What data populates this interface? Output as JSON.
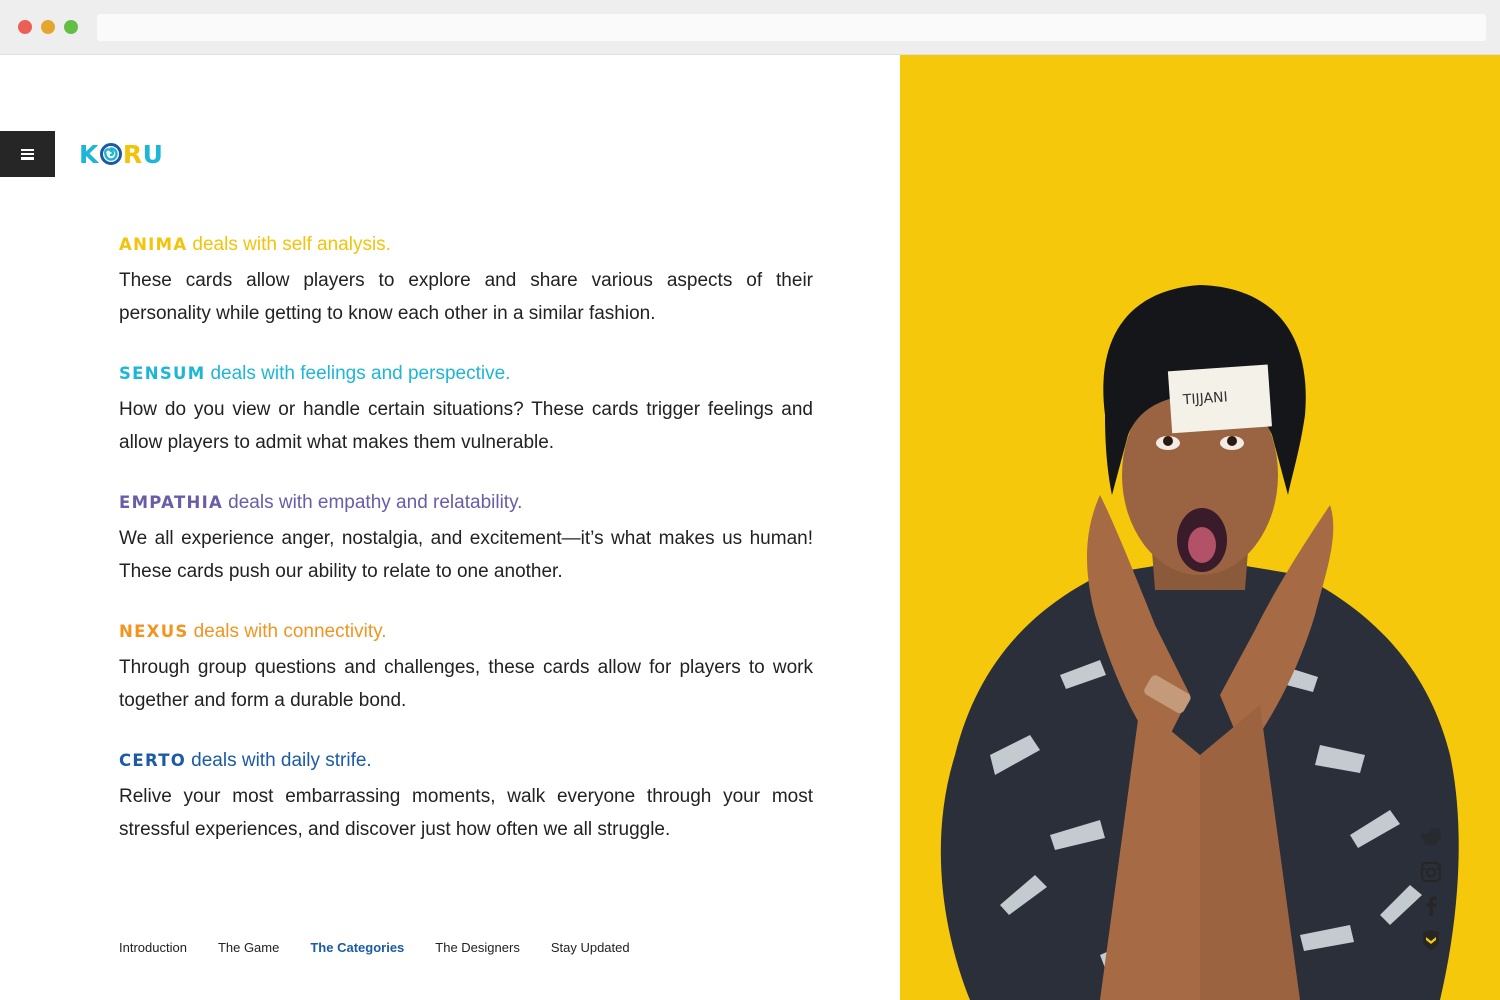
{
  "logo": {
    "k": "K",
    "r": "R",
    "u": "U"
  },
  "categories": [
    {
      "name": "ANIMA",
      "tagline": "deals with self analysis.",
      "color": "#f3c30a",
      "description": "These cards allow players to explore and share various aspects of their personality while getting to know each other in a similar fashion."
    },
    {
      "name": "SENSUM",
      "tagline": "deals with feelings and perspective.",
      "color": "#1eb6d6",
      "description": "How do you view or handle certain situations? These cards trigger feelings and allow players to admit what makes them vulnerable."
    },
    {
      "name": "EMPATHIA",
      "tagline": "deals with empathy and relatability.",
      "color": "#6a5ca8",
      "description": "We all experience anger, nostalgia, and excitement—it’s what makes us human! These cards push our ability to relate to one another."
    },
    {
      "name": "NEXUS",
      "tagline": "deals with connectivity.",
      "color": "#f2941f",
      "description": "Through group questions and challenges, these cards allow for players to work together and form a durable bond."
    },
    {
      "name": "CERTO",
      "tagline": "deals with daily strife.",
      "color": "#1b5aa5",
      "description": "Relive your most embarrassing moments, walk everyone through your most stressful experiences, and discover just how often we all struggle."
    }
  ],
  "nav": {
    "items": [
      "Introduction",
      "The Game",
      "The Categories",
      "The Designers",
      "Stay Updated"
    ],
    "active": "The Categories"
  },
  "photo": {
    "name_tag": "TIJJANI",
    "background": "#f5c80c"
  },
  "social_icons": [
    "twitter-icon",
    "instagram-icon",
    "facebook-icon",
    "badge-icon"
  ]
}
